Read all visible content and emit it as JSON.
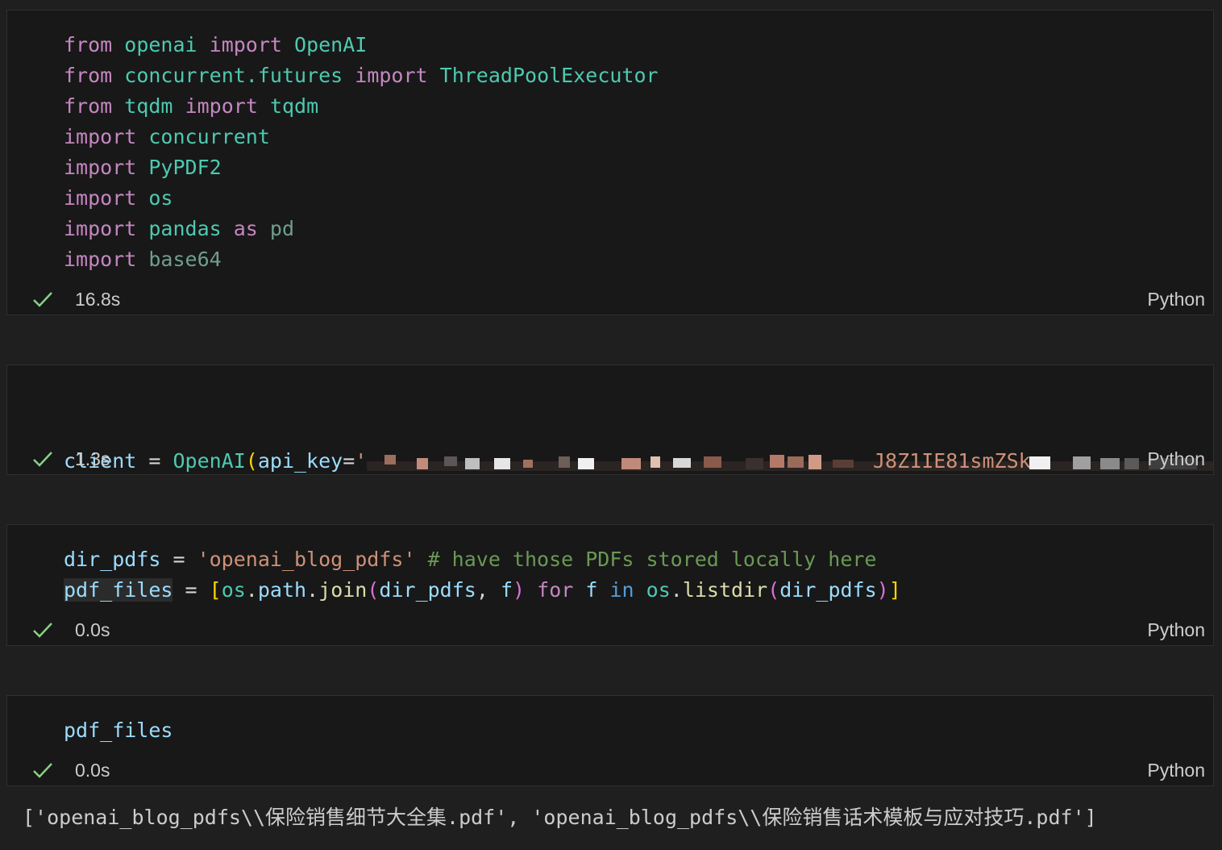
{
  "cells": [
    {
      "lines": [
        [
          [
            "kw",
            "from"
          ],
          [
            "op",
            " "
          ],
          [
            "mod",
            "openai"
          ],
          [
            "op",
            " "
          ],
          [
            "kw",
            "import"
          ],
          [
            "op",
            " "
          ],
          [
            "mod",
            "OpenAI"
          ]
        ],
        [
          [
            "kw",
            "from"
          ],
          [
            "op",
            " "
          ],
          [
            "mod",
            "concurrent.futures"
          ],
          [
            "op",
            " "
          ],
          [
            "kw",
            "import"
          ],
          [
            "op",
            " "
          ],
          [
            "mod",
            "ThreadPoolExecutor"
          ]
        ],
        [
          [
            "kw",
            "from"
          ],
          [
            "op",
            " "
          ],
          [
            "mod",
            "tqdm"
          ],
          [
            "op",
            " "
          ],
          [
            "kw",
            "import"
          ],
          [
            "op",
            " "
          ],
          [
            "mod",
            "tqdm"
          ]
        ],
        [
          [
            "kw",
            "import"
          ],
          [
            "op",
            " "
          ],
          [
            "mod",
            "concurrent"
          ]
        ],
        [
          [
            "kw",
            "import"
          ],
          [
            "op",
            " "
          ],
          [
            "mod",
            "PyPDF2"
          ]
        ],
        [
          [
            "kw",
            "import"
          ],
          [
            "op",
            " "
          ],
          [
            "mod",
            "os"
          ]
        ],
        [
          [
            "kw",
            "import"
          ],
          [
            "op",
            " "
          ],
          [
            "mod",
            "pandas"
          ],
          [
            "op",
            " "
          ],
          [
            "kw",
            "as"
          ],
          [
            "op",
            " "
          ],
          [
            "dim",
            "pd"
          ]
        ],
        [
          [
            "kw",
            "import"
          ],
          [
            "op",
            " "
          ],
          [
            "dim",
            "base64"
          ]
        ]
      ],
      "time": "16.8s",
      "language": "Python"
    },
    {
      "line_prefix": [
        [
          "var",
          "client"
        ],
        [
          "op",
          " = "
        ],
        [
          "mod",
          "OpenAI"
        ],
        [
          "yel",
          "("
        ],
        [
          "var",
          "api_key"
        ],
        [
          "op",
          "="
        ],
        [
          "str",
          "'"
        ]
      ],
      "redacted_tail": "J8Z1IE81smZSk",
      "time": "1.3s",
      "language": "Python"
    },
    {
      "lines": [
        [
          [
            "var",
            "dir_pdfs"
          ],
          [
            "op",
            " = "
          ],
          [
            "str",
            "'openai_blog_pdfs'"
          ],
          [
            "op",
            " "
          ],
          [
            "cm",
            "# have those PDFs stored locally here"
          ]
        ],
        [
          [
            "var hl",
            "pdf_files"
          ],
          [
            "op",
            " = "
          ],
          [
            "yel",
            "["
          ],
          [
            "mod",
            "os"
          ],
          [
            "op",
            "."
          ],
          [
            "var",
            "path"
          ],
          [
            "op",
            "."
          ],
          [
            "fn",
            "join"
          ],
          [
            "pur",
            "("
          ],
          [
            "var",
            "dir_pdfs"
          ],
          [
            "op",
            ", "
          ],
          [
            "var",
            "f"
          ],
          [
            "pur",
            ")"
          ],
          [
            "op",
            " "
          ],
          [
            "kw",
            "for"
          ],
          [
            "op",
            " "
          ],
          [
            "var",
            "f"
          ],
          [
            "op",
            " "
          ],
          [
            "blue",
            "in"
          ],
          [
            "op",
            " "
          ],
          [
            "mod",
            "os"
          ],
          [
            "op",
            "."
          ],
          [
            "fn",
            "listdir"
          ],
          [
            "pur",
            "("
          ],
          [
            "var",
            "dir_pdfs"
          ],
          [
            "pur",
            ")"
          ],
          [
            "yel",
            "]"
          ]
        ]
      ],
      "time": "0.0s",
      "language": "Python"
    },
    {
      "lines": [
        [
          [
            "var",
            "pdf_files"
          ]
        ]
      ],
      "time": "0.0s",
      "language": "Python"
    }
  ],
  "output": "['openai_blog_pdfs\\\\保险销售细节大全集.pdf', 'openai_blog_pdfs\\\\保险销售话术模板与应对技巧.pdf']",
  "icons": {
    "success": "check-icon"
  }
}
